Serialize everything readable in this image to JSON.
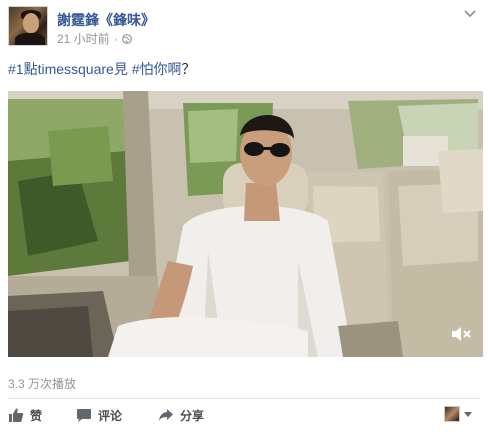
{
  "post": {
    "author": "謝霆鋒《鋒味》",
    "timestamp": "21 小时前",
    "separator": "·",
    "text_tag1": "#1點timessquare見",
    "text_space": " ",
    "text_tag2": "#怕你啊",
    "text_suffix": "？"
  },
  "video": {
    "views": "3.3 万次播放"
  },
  "actions": {
    "like": "赞",
    "comment": "评论",
    "share": "分享"
  },
  "colors": {
    "link": "#365899",
    "muted": "#90949c",
    "action": "#4b4f56"
  },
  "icons": {
    "privacy": "globe-icon",
    "options": "chevron-down-icon",
    "like": "thumbs-up-icon",
    "comment": "speech-bubble-icon",
    "share": "share-arrow-icon",
    "mute": "speaker-muted-icon"
  }
}
